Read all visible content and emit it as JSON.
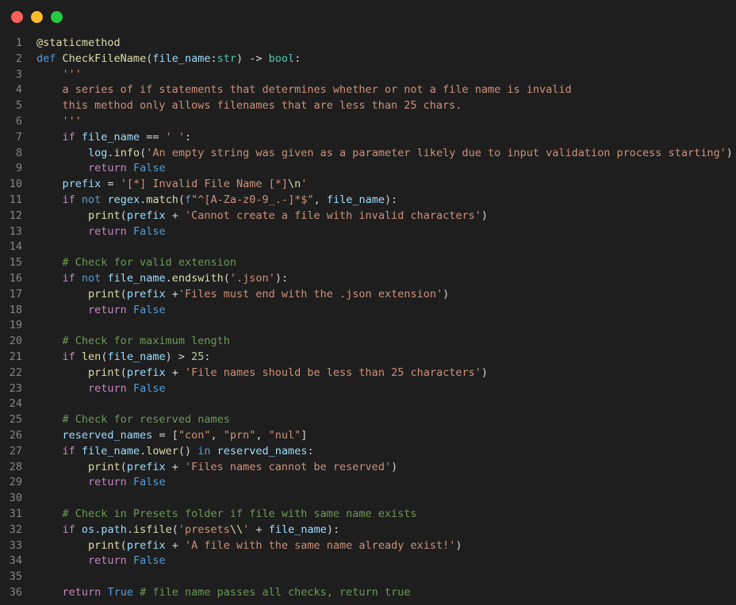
{
  "window": {
    "controls": {
      "close_color": "#ff5f56",
      "minimize_color": "#ffbd2e",
      "maximize_color": "#27c93f"
    }
  },
  "code": {
    "lines": [
      {
        "n": "1",
        "tokens": [
          [
            "dec",
            "@staticmethod"
          ]
        ]
      },
      {
        "n": "2",
        "tokens": [
          [
            "kw",
            "def"
          ],
          [
            "pl",
            " "
          ],
          [
            "fn",
            "CheckFileName"
          ],
          [
            "pl",
            "("
          ],
          [
            "var",
            "file_name"
          ],
          [
            "pl",
            ":"
          ],
          [
            "typ",
            "str"
          ],
          [
            "pl",
            ") -> "
          ],
          [
            "typ",
            "bool"
          ],
          [
            "pl",
            ":"
          ]
        ]
      },
      {
        "n": "3",
        "tokens": [
          [
            "pl",
            "    "
          ],
          [
            "str",
            "'''"
          ]
        ]
      },
      {
        "n": "4",
        "tokens": [
          [
            "pl",
            "    "
          ],
          [
            "str",
            "a series of if statements that determines whether or not a file name is invalid"
          ]
        ]
      },
      {
        "n": "5",
        "tokens": [
          [
            "pl",
            "    "
          ],
          [
            "str",
            "this method only allows filenames that are less than 25 chars."
          ]
        ]
      },
      {
        "n": "6",
        "tokens": [
          [
            "pl",
            "    "
          ],
          [
            "str",
            "'''"
          ]
        ]
      },
      {
        "n": "7",
        "tokens": [
          [
            "pl",
            "    "
          ],
          [
            "ctl",
            "if"
          ],
          [
            "pl",
            " "
          ],
          [
            "var",
            "file_name"
          ],
          [
            "pl",
            " == "
          ],
          [
            "str",
            "' '"
          ],
          [
            "pl",
            ":"
          ]
        ]
      },
      {
        "n": "8",
        "tokens": [
          [
            "pl",
            "        "
          ],
          [
            "var",
            "log"
          ],
          [
            "pl",
            "."
          ],
          [
            "fn",
            "info"
          ],
          [
            "pl",
            "("
          ],
          [
            "str",
            "'An empty string was given as a parameter likely due to input validation process starting'"
          ],
          [
            "pl",
            ")"
          ]
        ]
      },
      {
        "n": "9",
        "tokens": [
          [
            "pl",
            "        "
          ],
          [
            "ctl",
            "return"
          ],
          [
            "pl",
            " "
          ],
          [
            "kw",
            "False"
          ]
        ]
      },
      {
        "n": "10",
        "tokens": [
          [
            "pl",
            "    "
          ],
          [
            "var",
            "prefix"
          ],
          [
            "pl",
            " = "
          ],
          [
            "str",
            "'[*] Invalid File Name [*]"
          ],
          [
            "fn",
            "\\n"
          ],
          [
            "str",
            "'"
          ]
        ]
      },
      {
        "n": "11",
        "tokens": [
          [
            "pl",
            "    "
          ],
          [
            "ctl",
            "if"
          ],
          [
            "pl",
            " "
          ],
          [
            "kw",
            "not"
          ],
          [
            "pl",
            " "
          ],
          [
            "var",
            "regex"
          ],
          [
            "pl",
            "."
          ],
          [
            "fn",
            "match"
          ],
          [
            "pl",
            "("
          ],
          [
            "kw",
            "f"
          ],
          [
            "str",
            "\"^[A-Za-z0-9_.-]*$\""
          ],
          [
            "pl",
            ", "
          ],
          [
            "var",
            "file_name"
          ],
          [
            "pl",
            "):"
          ]
        ]
      },
      {
        "n": "12",
        "tokens": [
          [
            "pl",
            "        "
          ],
          [
            "fn",
            "print"
          ],
          [
            "pl",
            "("
          ],
          [
            "var",
            "prefix"
          ],
          [
            "pl",
            " + "
          ],
          [
            "str",
            "'Cannot create a file with invalid characters'"
          ],
          [
            "pl",
            ")"
          ]
        ]
      },
      {
        "n": "13",
        "tokens": [
          [
            "pl",
            "        "
          ],
          [
            "ctl",
            "return"
          ],
          [
            "pl",
            " "
          ],
          [
            "kw",
            "False"
          ]
        ]
      },
      {
        "n": "14",
        "tokens": []
      },
      {
        "n": "15",
        "tokens": [
          [
            "pl",
            "    "
          ],
          [
            "com",
            "# Check for valid extension"
          ]
        ]
      },
      {
        "n": "16",
        "tokens": [
          [
            "pl",
            "    "
          ],
          [
            "ctl",
            "if"
          ],
          [
            "pl",
            " "
          ],
          [
            "kw",
            "not"
          ],
          [
            "pl",
            " "
          ],
          [
            "var",
            "file_name"
          ],
          [
            "pl",
            "."
          ],
          [
            "fn",
            "endswith"
          ],
          [
            "pl",
            "("
          ],
          [
            "str",
            "'.json'"
          ],
          [
            "pl",
            "):"
          ]
        ]
      },
      {
        "n": "17",
        "tokens": [
          [
            "pl",
            "        "
          ],
          [
            "fn",
            "print"
          ],
          [
            "pl",
            "("
          ],
          [
            "var",
            "prefix"
          ],
          [
            "pl",
            " +"
          ],
          [
            "str",
            "'Files must end with the .json extension'"
          ],
          [
            "pl",
            ")"
          ]
        ]
      },
      {
        "n": "18",
        "tokens": [
          [
            "pl",
            "        "
          ],
          [
            "ctl",
            "return"
          ],
          [
            "pl",
            " "
          ],
          [
            "kw",
            "False"
          ]
        ]
      },
      {
        "n": "19",
        "tokens": []
      },
      {
        "n": "20",
        "tokens": [
          [
            "pl",
            "    "
          ],
          [
            "com",
            "# Check for maximum length"
          ]
        ]
      },
      {
        "n": "21",
        "tokens": [
          [
            "pl",
            "    "
          ],
          [
            "ctl",
            "if"
          ],
          [
            "pl",
            " "
          ],
          [
            "fn",
            "len"
          ],
          [
            "pl",
            "("
          ],
          [
            "var",
            "file_name"
          ],
          [
            "pl",
            ") > "
          ],
          [
            "num",
            "25"
          ],
          [
            "pl",
            ":"
          ]
        ]
      },
      {
        "n": "22",
        "tokens": [
          [
            "pl",
            "        "
          ],
          [
            "fn",
            "print"
          ],
          [
            "pl",
            "("
          ],
          [
            "var",
            "prefix"
          ],
          [
            "pl",
            " + "
          ],
          [
            "str",
            "'File names should be less than 25 characters'"
          ],
          [
            "pl",
            ")"
          ]
        ]
      },
      {
        "n": "23",
        "tokens": [
          [
            "pl",
            "        "
          ],
          [
            "ctl",
            "return"
          ],
          [
            "pl",
            " "
          ],
          [
            "kw",
            "False"
          ]
        ]
      },
      {
        "n": "24",
        "tokens": []
      },
      {
        "n": "25",
        "tokens": [
          [
            "pl",
            "    "
          ],
          [
            "com",
            "# Check for reserved names"
          ]
        ]
      },
      {
        "n": "26",
        "tokens": [
          [
            "pl",
            "    "
          ],
          [
            "var",
            "reserved_names"
          ],
          [
            "pl",
            " = ["
          ],
          [
            "str",
            "\"con\""
          ],
          [
            "pl",
            ", "
          ],
          [
            "str",
            "\"prn\""
          ],
          [
            "pl",
            ", "
          ],
          [
            "str",
            "\"nul\""
          ],
          [
            "pl",
            "]"
          ]
        ]
      },
      {
        "n": "27",
        "tokens": [
          [
            "pl",
            "    "
          ],
          [
            "ctl",
            "if"
          ],
          [
            "pl",
            " "
          ],
          [
            "var",
            "file_name"
          ],
          [
            "pl",
            "."
          ],
          [
            "fn",
            "lower"
          ],
          [
            "pl",
            "() "
          ],
          [
            "kw",
            "in"
          ],
          [
            "pl",
            " "
          ],
          [
            "var",
            "reserved_names"
          ],
          [
            "pl",
            ":"
          ]
        ]
      },
      {
        "n": "28",
        "tokens": [
          [
            "pl",
            "        "
          ],
          [
            "fn",
            "print"
          ],
          [
            "pl",
            "("
          ],
          [
            "var",
            "prefix"
          ],
          [
            "pl",
            " + "
          ],
          [
            "str",
            "'Files names cannot be reserved'"
          ],
          [
            "pl",
            ")"
          ]
        ]
      },
      {
        "n": "29",
        "tokens": [
          [
            "pl",
            "        "
          ],
          [
            "ctl",
            "return"
          ],
          [
            "pl",
            " "
          ],
          [
            "kw",
            "False"
          ]
        ]
      },
      {
        "n": "30",
        "tokens": []
      },
      {
        "n": "31",
        "tokens": [
          [
            "pl",
            "    "
          ],
          [
            "com",
            "# Check in Presets folder if file with same name exists"
          ]
        ]
      },
      {
        "n": "32",
        "tokens": [
          [
            "pl",
            "    "
          ],
          [
            "ctl",
            "if"
          ],
          [
            "pl",
            " "
          ],
          [
            "var",
            "os"
          ],
          [
            "pl",
            "."
          ],
          [
            "var",
            "path"
          ],
          [
            "pl",
            "."
          ],
          [
            "fn",
            "isfile"
          ],
          [
            "pl",
            "("
          ],
          [
            "str",
            "'presets"
          ],
          [
            "fn",
            "\\\\"
          ],
          [
            "str",
            "'"
          ],
          [
            "pl",
            " + "
          ],
          [
            "var",
            "file_name"
          ],
          [
            "pl",
            "):"
          ]
        ]
      },
      {
        "n": "33",
        "tokens": [
          [
            "pl",
            "        "
          ],
          [
            "fn",
            "print"
          ],
          [
            "pl",
            "("
          ],
          [
            "var",
            "prefix"
          ],
          [
            "pl",
            " + "
          ],
          [
            "str",
            "'A file with the same name already exist!'"
          ],
          [
            "pl",
            ")"
          ]
        ]
      },
      {
        "n": "34",
        "tokens": [
          [
            "pl",
            "        "
          ],
          [
            "ctl",
            "return"
          ],
          [
            "pl",
            " "
          ],
          [
            "kw",
            "False"
          ]
        ]
      },
      {
        "n": "35",
        "tokens": []
      },
      {
        "n": "36",
        "tokens": [
          [
            "pl",
            "    "
          ],
          [
            "ctl",
            "return"
          ],
          [
            "pl",
            " "
          ],
          [
            "kw",
            "True"
          ],
          [
            "pl",
            " "
          ],
          [
            "com",
            "# file name passes all checks, return true"
          ]
        ]
      }
    ]
  }
}
